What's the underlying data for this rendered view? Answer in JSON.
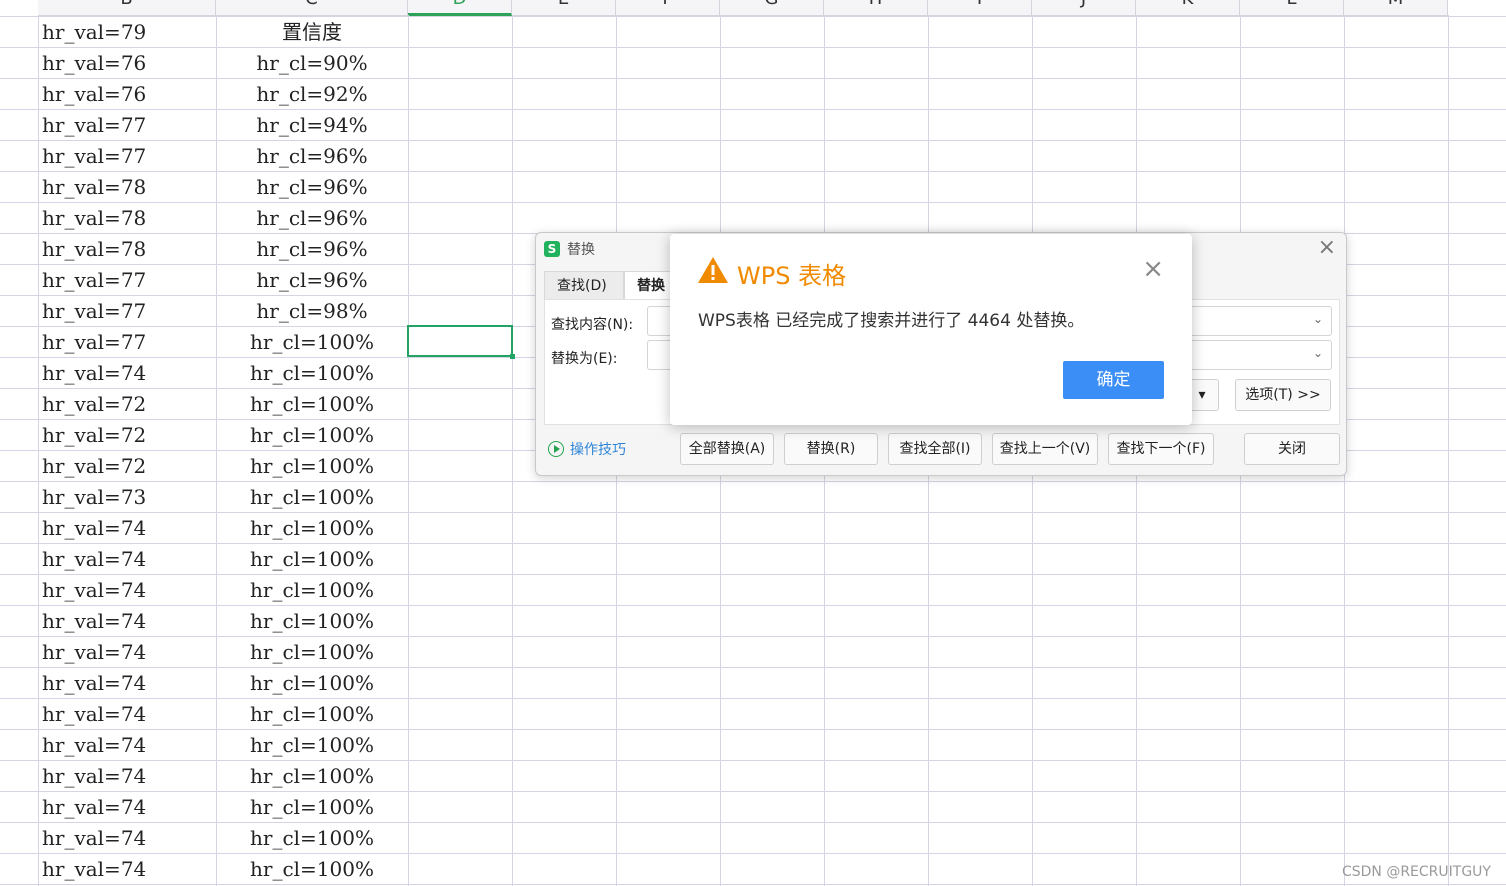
{
  "spreadsheet": {
    "column_headers": [
      "B",
      "C",
      "D",
      "E",
      "F",
      "G",
      "H",
      "I",
      "J",
      "K",
      "L",
      "M"
    ],
    "rows": [
      {
        "b": "hr_val=79",
        "c": "置信度"
      },
      {
        "b": "hr_val=76",
        "c": "hr_cl=90%"
      },
      {
        "b": "hr_val=76",
        "c": "hr_cl=92%"
      },
      {
        "b": "hr_val=77",
        "c": "hr_cl=94%"
      },
      {
        "b": "hr_val=77",
        "c": "hr_cl=96%"
      },
      {
        "b": "hr_val=78",
        "c": "hr_cl=96%"
      },
      {
        "b": "hr_val=78",
        "c": "hr_cl=96%"
      },
      {
        "b": "hr_val=78",
        "c": "hr_cl=96%"
      },
      {
        "b": "hr_val=77",
        "c": "hr_cl=96%"
      },
      {
        "b": "hr_val=77",
        "c": "hr_cl=98%"
      },
      {
        "b": "hr_val=77",
        "c": "hr_cl=100%"
      },
      {
        "b": "hr_val=74",
        "c": "hr_cl=100%"
      },
      {
        "b": "hr_val=72",
        "c": "hr_cl=100%"
      },
      {
        "b": "hr_val=72",
        "c": "hr_cl=100%"
      },
      {
        "b": "hr_val=72",
        "c": "hr_cl=100%"
      },
      {
        "b": "hr_val=73",
        "c": "hr_cl=100%"
      },
      {
        "b": "hr_val=74",
        "c": "hr_cl=100%"
      },
      {
        "b": "hr_val=74",
        "c": "hr_cl=100%"
      },
      {
        "b": "hr_val=74",
        "c": "hr_cl=100%"
      },
      {
        "b": "hr_val=74",
        "c": "hr_cl=100%"
      },
      {
        "b": "hr_val=74",
        "c": "hr_cl=100%"
      },
      {
        "b": "hr_val=74",
        "c": "hr_cl=100%"
      },
      {
        "b": "hr_val=74",
        "c": "hr_cl=100%"
      },
      {
        "b": "hr_val=74",
        "c": "hr_cl=100%"
      },
      {
        "b": "hr_val=74",
        "c": "hr_cl=100%"
      },
      {
        "b": "hr_val=74",
        "c": "hr_cl=100%"
      },
      {
        "b": "hr_val=74",
        "c": "hr_cl=100%"
      },
      {
        "b": "hr_val=74",
        "c": "hr_cl=100%"
      }
    ]
  },
  "replace_dialog": {
    "logo": "S",
    "title": "替换",
    "close_icon": "×",
    "tabs": [
      "查找(D)",
      "替换"
    ],
    "find_label": "查找内容(N):",
    "replace_label": "替换为(E):",
    "options_button": "选项(T) >>",
    "tips_link": "操作技巧",
    "buttons": {
      "replace_all": "全部替换(A)",
      "replace": "替换(R)",
      "find_all": "查找全部(I)",
      "find_prev": "查找上一个(V)",
      "find_next": "查找下一个(F)",
      "close": "关闭"
    }
  },
  "alert_dialog": {
    "title": "WPS 表格",
    "message": "WPS表格 已经完成了搜索并进行了 4464 处替换。",
    "ok_button": "确定",
    "close_icon": "×"
  },
  "watermark": "CSDN @RECRUITGUY",
  "colors": {
    "accent_green": "#21a366",
    "warning_orange": "#f08a00",
    "primary_blue": "#3c8ef7",
    "link_blue": "#2f86d8"
  }
}
